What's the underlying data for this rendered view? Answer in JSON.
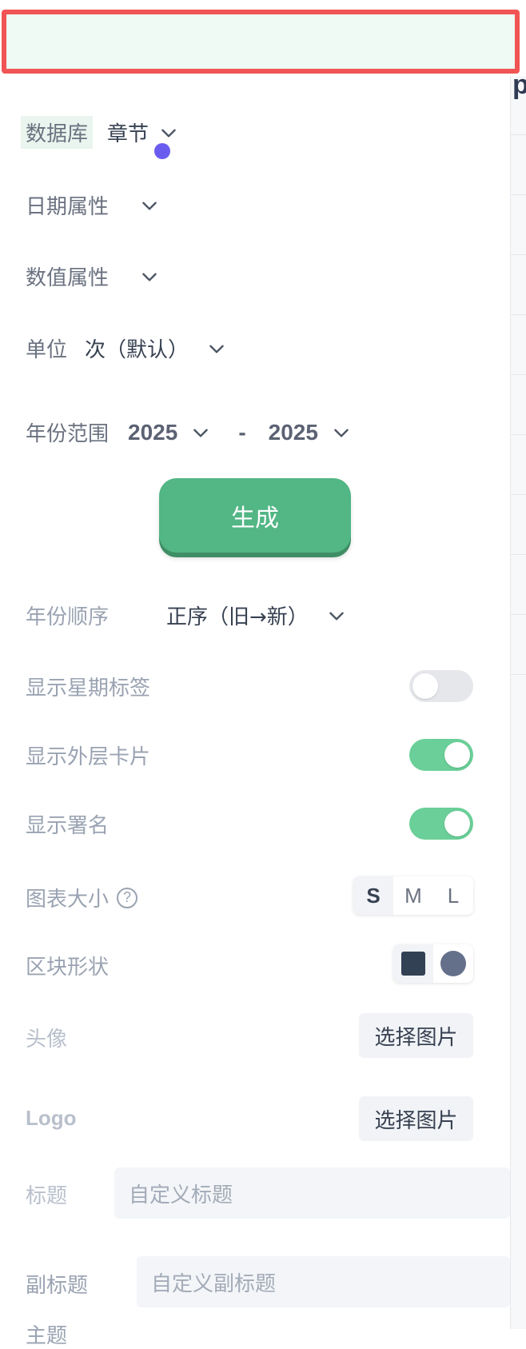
{
  "database": {
    "label": "数据库",
    "value": "章节"
  },
  "date_property": {
    "label": "日期属性"
  },
  "number_property": {
    "label": "数值属性"
  },
  "unit": {
    "label": "单位",
    "value": "次（默认）"
  },
  "year_range": {
    "label": "年份范围",
    "from": "2025",
    "separator": "-",
    "to": "2025"
  },
  "generate_button": {
    "label": "生成"
  },
  "year_order": {
    "label": "年份顺序",
    "value": "正序（旧→新）"
  },
  "show_weekday_labels": {
    "label": "显示星期标签",
    "on": false
  },
  "show_outer_card": {
    "label": "显示外层卡片",
    "on": true
  },
  "show_signature": {
    "label": "显示署名",
    "on": true
  },
  "chart_size": {
    "label": "图表大小",
    "help_glyph": "?",
    "options": [
      "S",
      "M",
      "L"
    ],
    "selected": "S"
  },
  "block_shape": {
    "label": "区块形状",
    "options": [
      "square-icon",
      "circle-icon"
    ],
    "selected": "square-icon"
  },
  "avatar": {
    "label": "头像",
    "button": "选择图片"
  },
  "logo": {
    "label": "Logo",
    "button": "选择图片"
  },
  "title": {
    "label": "标题",
    "placeholder": "自定义标题"
  },
  "subtitle": {
    "label": "副标题",
    "placeholder": "自定义副标题"
  },
  "partial_label": "主题",
  "edge_glyph": "p",
  "colors": {
    "accent": "#52b685",
    "toggle_on": "#6acf98",
    "highlight_border": "#f05454",
    "cursor_dot": "#6b5cf0"
  }
}
